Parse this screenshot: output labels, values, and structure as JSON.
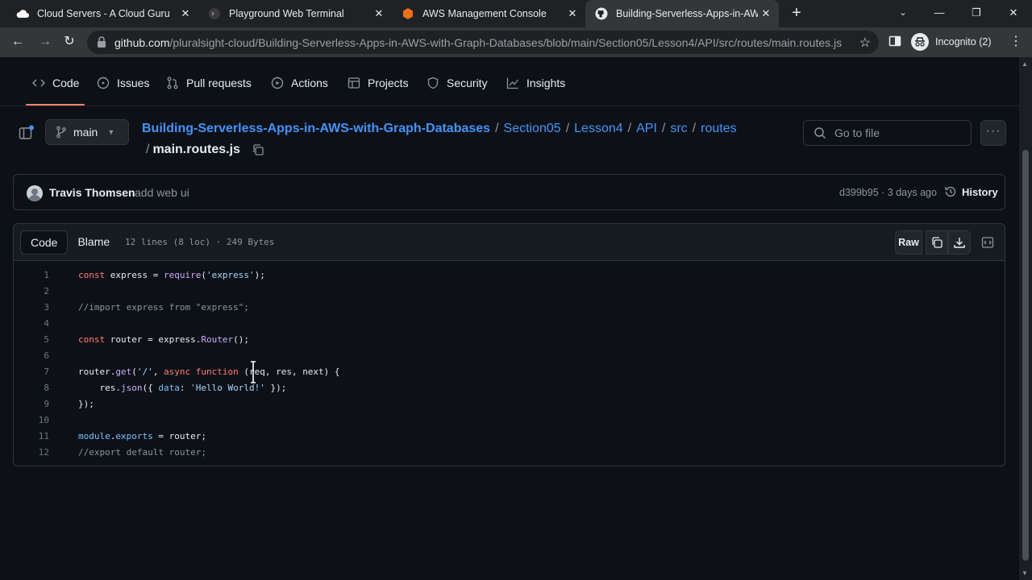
{
  "browser": {
    "tabs": [
      {
        "title": "Cloud Servers - A Cloud Guru",
        "icon": "cloud-icon"
      },
      {
        "title": "Playground Web Terminal",
        "icon": "terminal-icon"
      },
      {
        "title": "AWS Management Console",
        "icon": "aws-icon"
      },
      {
        "title": "Building-Serverless-Apps-in-AWS",
        "icon": "github-icon",
        "active": true
      }
    ],
    "url_host": "github.com",
    "url_path": "/pluralsight-cloud/Building-Serverless-Apps-in-AWS-with-Graph-Databases/blob/main/Section05/Lesson4/API/src/routes/main.routes.js",
    "profile_label": "Incognito (2)"
  },
  "repo_nav": {
    "items": [
      "Code",
      "Issues",
      "Pull requests",
      "Actions",
      "Projects",
      "Security",
      "Insights"
    ]
  },
  "branch": "main",
  "breadcrumb": {
    "repo": "Building-Serverless-Apps-in-AWS-with-Graph-Databases",
    "folders": [
      "Section05",
      "Lesson4",
      "API",
      "src",
      "routes"
    ],
    "file": "main.routes.js"
  },
  "search": {
    "placeholder": "Go to file"
  },
  "commit": {
    "author": "Travis Thomsen",
    "message": "add web ui",
    "meta": "d399b95 · 3 days ago",
    "history_label": "History"
  },
  "file": {
    "tabs": [
      "Code",
      "Blame"
    ],
    "info": "12 lines (8 loc) · 249 Bytes",
    "raw_label": "Raw",
    "lines": [
      "const express = require('express');",
      "",
      "//import express from \"express\";",
      "",
      "const router = express.Router();",
      "",
      "router.get('/', async function (req, res, next) {",
      "    res.json({ data: 'Hello World!' });",
      "});",
      "",
      "module.exports = router;",
      "//export default router;"
    ]
  },
  "colors": {
    "accent": "#4493f8",
    "underline": "#f78166",
    "background": "#0d1117"
  }
}
